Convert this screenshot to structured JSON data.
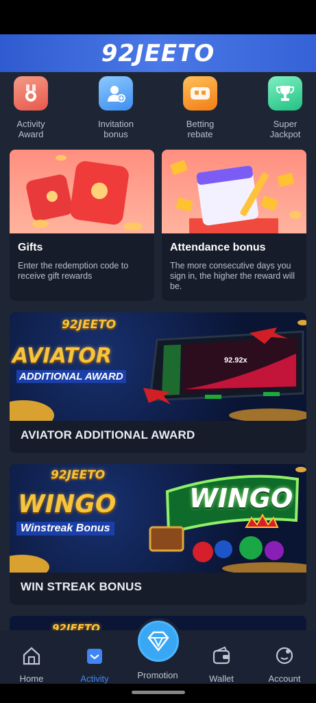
{
  "header": {
    "logo": "92JEETO"
  },
  "quick_actions": [
    {
      "label_line1": "Activity",
      "label_line2": "Award",
      "icon": "award-medal-icon",
      "color": "#f0776c"
    },
    {
      "label_line1": "Invitation",
      "label_line2": "bonus",
      "icon": "invite-user-icon",
      "color": "#5aa7f2"
    },
    {
      "label_line1": "Betting",
      "label_line2": "rebate",
      "icon": "rebate-icon",
      "color": "#f79a2e"
    },
    {
      "label_line1": "Super",
      "label_line2": "Jackpot",
      "icon": "trophy-icon",
      "color": "#39d29a"
    }
  ],
  "cards": [
    {
      "title": "Gifts",
      "desc": "Enter the redemption code to receive gift rewards"
    },
    {
      "title": "Attendance bonus",
      "desc": "The more consecutive days you sign in, the higher the reward will be."
    }
  ],
  "banners": [
    {
      "title": "AVIATOR ADDITIONAL AWARD",
      "art_logo": "92JEETO",
      "art_big": "AVIATOR",
      "art_sub": "ADDITIONAL AWARD",
      "art_value": "92.92x"
    },
    {
      "title": "WIN STREAK BONUS",
      "art_logo": "92JEETO",
      "art_big": "WINGO",
      "art_sub": "Winstreak Bonus",
      "art_game": "WINGO"
    }
  ],
  "partial_banner": {
    "art_logo": "92JEETO"
  },
  "tabs": [
    {
      "label": "Home",
      "icon": "home-icon",
      "active": false
    },
    {
      "label": "Activity",
      "icon": "activity-icon",
      "active": true
    },
    {
      "label": "Promotion",
      "icon": "diamond-icon",
      "active": false
    },
    {
      "label": "Wallet",
      "icon": "wallet-icon",
      "active": false
    },
    {
      "label": "Account",
      "icon": "account-icon",
      "active": false
    }
  ],
  "colors": {
    "accent": "#3f86f4",
    "header": "#3a68da",
    "bg": "#1e2534",
    "card": "#161c29"
  }
}
